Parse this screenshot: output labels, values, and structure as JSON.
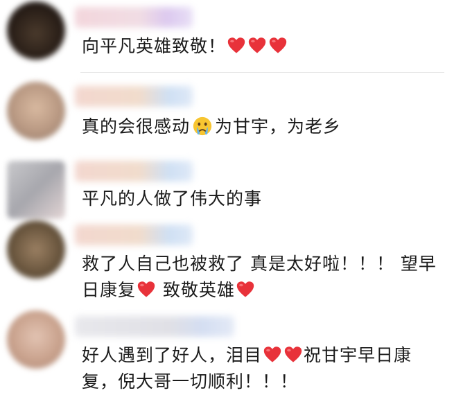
{
  "comments": [
    {
      "text_before": "向平凡英雄致敬！",
      "emoji": [
        "heart-emoji",
        "heart-emoji",
        "heart-emoji"
      ]
    },
    {
      "text_before": "真的会很感动",
      "emoji_mid": "crying-face-emoji",
      "text_after": "为甘宇，为老乡"
    },
    {
      "text_before": "平凡的人做了伟大的事"
    },
    {
      "line1": "救了人自己也被救了 真是太好啦！！！ 望早",
      "line2_a": "日康复",
      "line2_b": "致敬英雄"
    },
    {
      "line1_a": "好人遇到了好人，泪目",
      "line1_b": "祝甘宇早日康",
      "line2": "复，倪大哥一切顺利！！！"
    }
  ],
  "colors": {
    "heart": "#e8323a",
    "text": "#1a1a1a",
    "divider": "#e6e6e6"
  }
}
